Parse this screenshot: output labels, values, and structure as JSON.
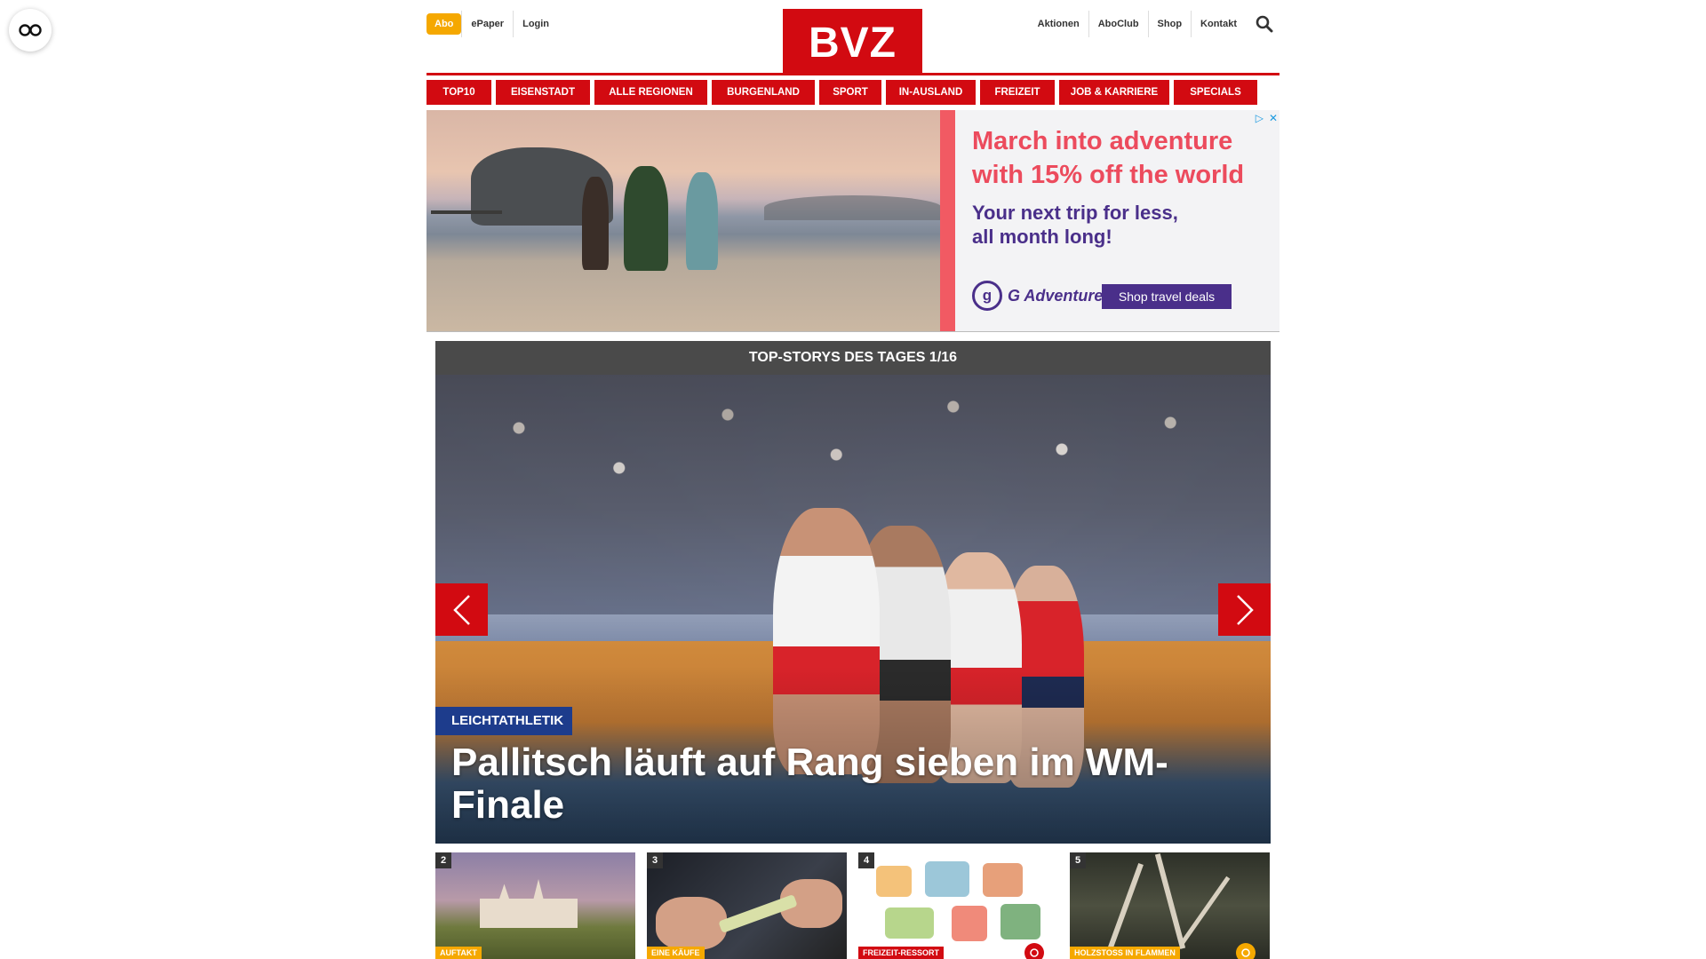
{
  "accessibility": {
    "icon": "glasses-icon"
  },
  "topbar": {
    "abo_label": "Abo",
    "left_links": [
      "ePaper",
      "Login"
    ],
    "right_links": [
      "Aktionen",
      "AboClub",
      "Shop",
      "Kontakt"
    ],
    "search_icon": "search-icon",
    "logo_text": "BVZ",
    "brand_color": "#d20a11"
  },
  "nav": {
    "items": [
      "TOP10",
      "EISENSTADT",
      "ALLE REGIONEN",
      "BURGENLAND",
      "SPORT",
      "IN-AUSLAND",
      "FREIZEIT",
      "JOB & KARRIERE",
      "SPECIALS"
    ]
  },
  "ad": {
    "headline": "March into adventure with 15% off the world",
    "subline": "Your next trip for less, all month long!",
    "brand": "G Adventures",
    "cta": "Shop travel deals",
    "accent_color": "#ec4b5d",
    "brand_color": "#4a2f8a"
  },
  "top_stories": {
    "header": "TOP-STORYS DES TAGES 1/16",
    "hero": {
      "category": "LEICHTATHLETIK",
      "headline": "Pallitsch läuft auf Rang sieben im WM-Finale"
    },
    "prev_icon": "chevron-left-icon",
    "next_icon": "chevron-right-icon"
  },
  "thumbnails": [
    {
      "number": "2",
      "category": "AUFTAKT"
    },
    {
      "number": "3",
      "category": "EINE KÄUFE"
    },
    {
      "number": "4",
      "category": "FREIZEIT-RESSORT",
      "badge_icon": "camera-icon"
    },
    {
      "number": "5",
      "category": "HOLZSTOSS IN FLAMMEN",
      "badge_icon": "camera-icon"
    }
  ]
}
